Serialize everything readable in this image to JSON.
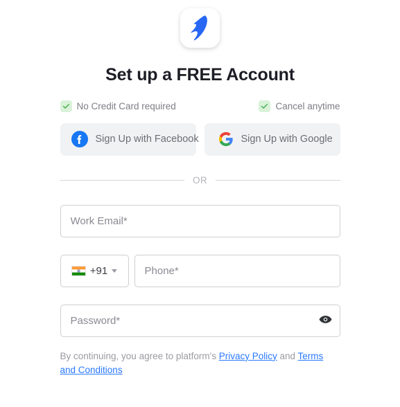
{
  "brand": {
    "logo_icon": "penguin-logo-icon",
    "logo_color": "#2767f4"
  },
  "header": {
    "title": "Set up a FREE Account"
  },
  "assurances": [
    {
      "icon": "check-icon",
      "label": "No Credit Card required"
    },
    {
      "icon": "check-icon",
      "label": "Cancel anytime"
    }
  ],
  "social_buttons": [
    {
      "provider": "facebook",
      "icon": "facebook-icon",
      "label": "Sign Up with Facebook",
      "color": "#1877f2"
    },
    {
      "provider": "google",
      "icon": "google-icon",
      "label": "Sign Up with Google",
      "color": "#4285f4"
    }
  ],
  "divider": {
    "text": "OR"
  },
  "form": {
    "email": {
      "placeholder": "Work Email*",
      "value": ""
    },
    "country": {
      "flag_icon": "india-flag-icon",
      "dial_code": "+91",
      "caret_icon": "chevron-down-icon"
    },
    "phone": {
      "placeholder": "Phone*",
      "value": ""
    },
    "password": {
      "placeholder": "Password*",
      "value": "",
      "toggle_icon": "eye-icon"
    }
  },
  "legal": {
    "prefix": "By continuing, you agree to platform's ",
    "privacy_link": "Privacy Policy",
    "conjunction": " and ",
    "terms_link": "Terms and Conditions",
    "link_color": "#2979ff"
  }
}
